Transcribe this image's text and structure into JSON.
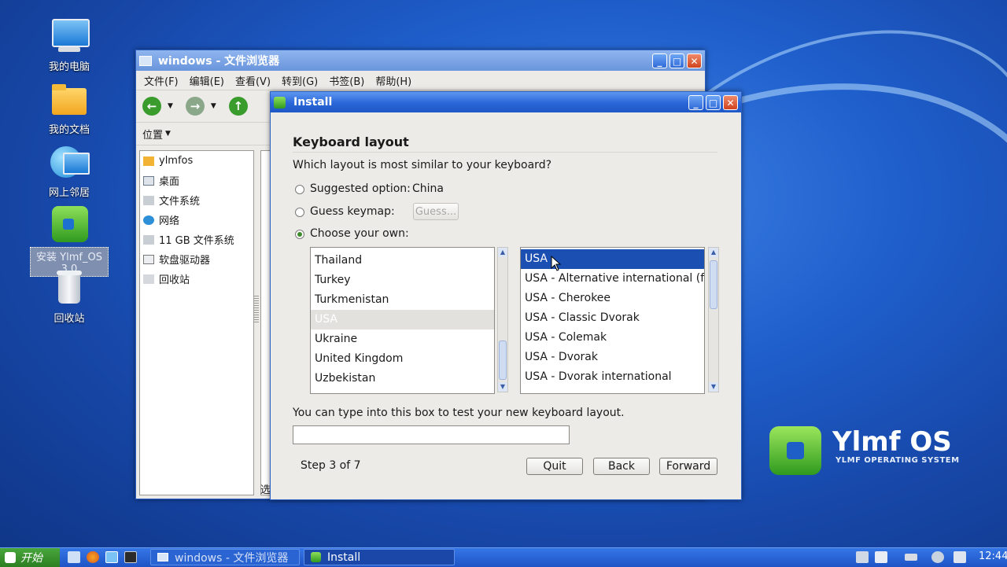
{
  "desktop": {
    "icons": [
      {
        "label": "我的电脑"
      },
      {
        "label": "我的文档"
      },
      {
        "label": "网上邻居"
      },
      {
        "label": "安装 Ylmf_OS 3.0"
      },
      {
        "label": "回收站"
      }
    ],
    "brand": {
      "name": "Ylmf OS",
      "tagline": "YLMF OPERATING SYSTEM"
    }
  },
  "file_browser": {
    "title": "windows - 文件浏览器",
    "menu": [
      "文件(F)",
      "编辑(E)",
      "查看(V)",
      "转到(G)",
      "书签(B)",
      "帮助(H)"
    ],
    "side_header": "位置",
    "places": [
      "ylmfos",
      "桌面",
      "文件系统",
      "网络",
      "11 GB 文件系统",
      "软盘驱动器",
      "回收站"
    ],
    "status_fragment": "选"
  },
  "install": {
    "title": "Install",
    "heading": "Keyboard layout",
    "question": "Which layout is most similar to your keyboard?",
    "suggested_label": "Suggested option:",
    "suggested_value": "China",
    "guess_label": "Guess keymap:",
    "guess_button": "Guess...",
    "choose_label": "Choose your own:",
    "countries": [
      "Thailand",
      "Turkey",
      "Turkmenistan",
      "USA",
      "Ukraine",
      "United Kingdom",
      "Uzbekistan"
    ],
    "selected_country": "USA",
    "variants": [
      "USA",
      "USA - Alternative international (for",
      "USA - Cherokee",
      "USA - Classic Dvorak",
      "USA - Colemak",
      "USA - Dvorak",
      "USA - Dvorak international"
    ],
    "selected_variant": "USA",
    "test_prompt": "You can type into this box to test your new keyboard layout.",
    "test_value": "",
    "step": "Step 3 of 7",
    "quit": "Quit",
    "back": "Back",
    "forward": "Forward"
  },
  "taskbar": {
    "start": "开始",
    "tasks": [
      "windows - 文件浏览器",
      "Install"
    ],
    "clock": "12:44"
  }
}
